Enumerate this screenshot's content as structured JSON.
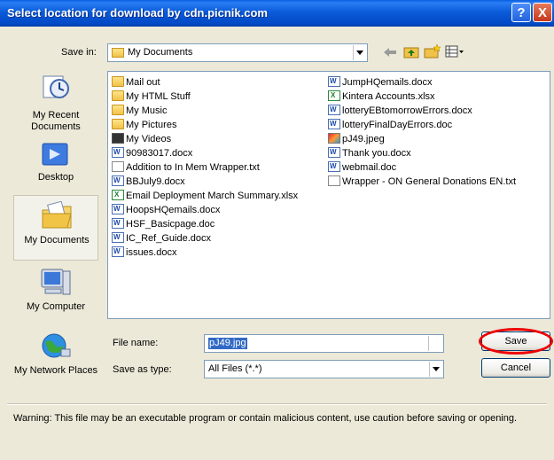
{
  "window": {
    "title": "Select location for download by cdn.picnik.com",
    "help_label": "?",
    "close_label": "X"
  },
  "toolbar": {
    "save_in_label": "Save in:",
    "save_in_value": "My Documents"
  },
  "places": [
    {
      "label": "My Recent Documents",
      "icon": "recent-documents-icon"
    },
    {
      "label": "Desktop",
      "icon": "desktop-icon"
    },
    {
      "label": "My Documents",
      "icon": "my-documents-icon"
    },
    {
      "label": "My Computer",
      "icon": "my-computer-icon"
    },
    {
      "label": "My Network Places",
      "icon": "network-places-icon"
    }
  ],
  "files_col1": [
    {
      "name": "Mail out",
      "type": "folder"
    },
    {
      "name": "My HTML Stuff",
      "type": "folder"
    },
    {
      "name": "My Music",
      "type": "folder"
    },
    {
      "name": "My Pictures",
      "type": "folder"
    },
    {
      "name": "My Videos",
      "type": "video"
    },
    {
      "name": "90983017.docx",
      "type": "word"
    },
    {
      "name": "Addition to In Mem Wrapper.txt",
      "type": "txt"
    },
    {
      "name": "BBJuly9.docx",
      "type": "word"
    },
    {
      "name": "Email Deployment March Summary.xlsx",
      "type": "excel"
    },
    {
      "name": "HoopsHQemails.docx",
      "type": "word"
    },
    {
      "name": "HSF_Basicpage.doc",
      "type": "word"
    },
    {
      "name": "IC_Ref_Guide.docx",
      "type": "word"
    },
    {
      "name": "issues.docx",
      "type": "word"
    }
  ],
  "files_col2": [
    {
      "name": "JumpHQemails.docx",
      "type": "word"
    },
    {
      "name": "Kintera Accounts.xlsx",
      "type": "excel"
    },
    {
      "name": "lotteryEBtomorrowErrors.docx",
      "type": "word"
    },
    {
      "name": "lotteryFinalDayErrors.doc",
      "type": "word"
    },
    {
      "name": "pJ49.jpeg",
      "type": "img"
    },
    {
      "name": "Thank you.docx",
      "type": "word"
    },
    {
      "name": "webmail.doc",
      "type": "word"
    },
    {
      "name": "Wrapper - ON General Donations EN.txt",
      "type": "txt"
    }
  ],
  "form": {
    "file_name_label": "File name:",
    "file_name_value": "pJ49.jpg",
    "save_as_type_label": "Save as type:",
    "save_as_type_value": "All Files (*.*)"
  },
  "buttons": {
    "save": "Save",
    "cancel": "Cancel"
  },
  "warning": "Warning: This file may be an executable program or contain malicious content, use caution before saving or opening."
}
